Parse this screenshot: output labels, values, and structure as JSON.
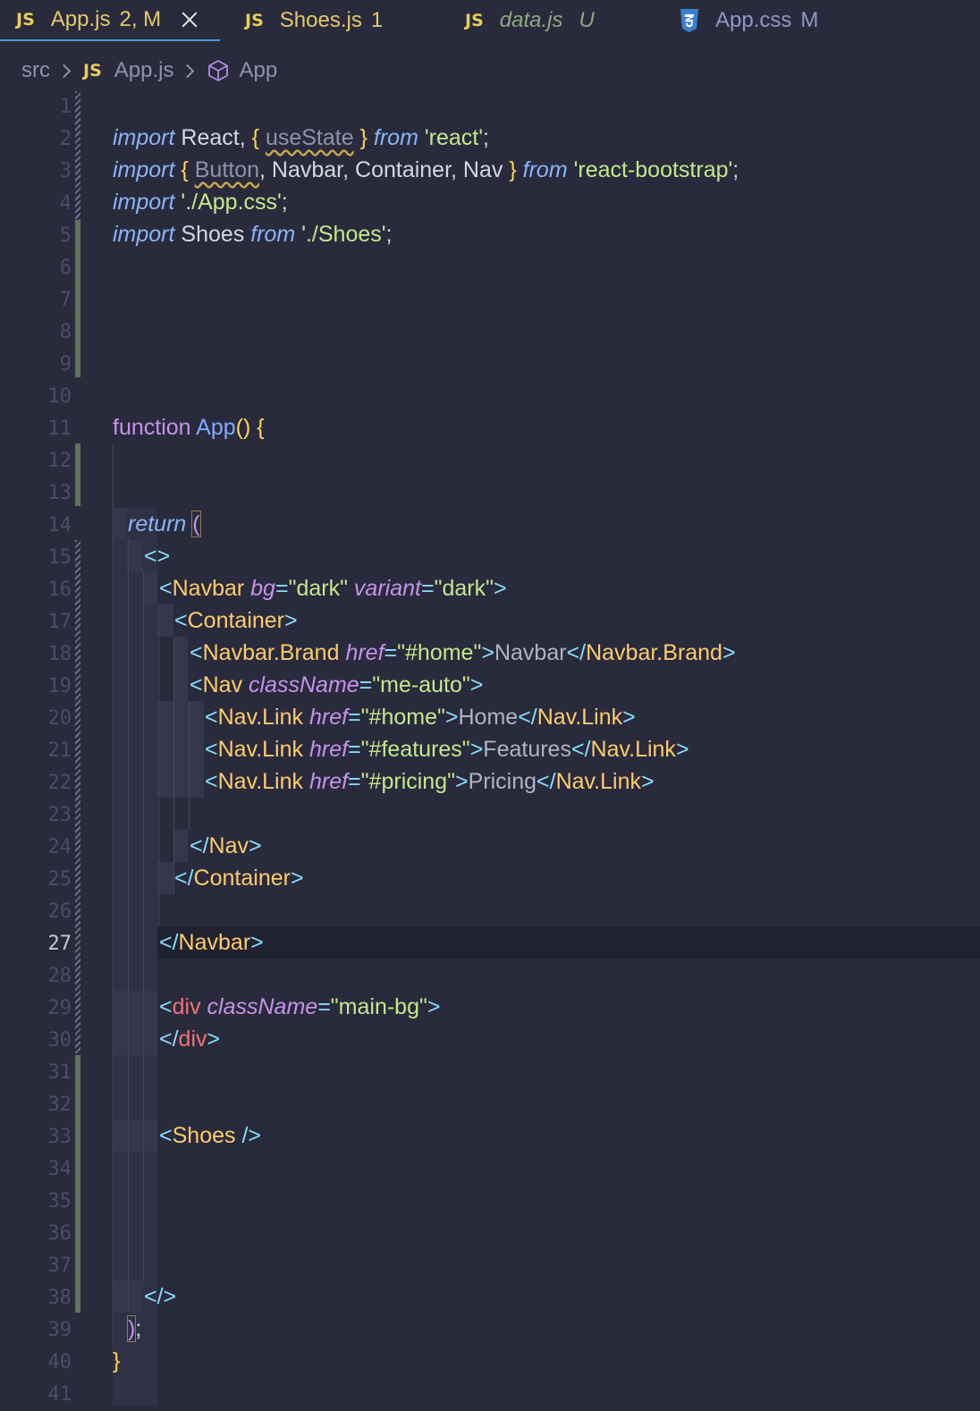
{
  "tabs": [
    {
      "name": "App.js",
      "status": "2, M",
      "icon": "js-icon",
      "color": "#e6c86a",
      "status_color": "#e6c86a",
      "active": true
    },
    {
      "name": "Shoes.js",
      "status": "1",
      "icon": "js-icon",
      "color": "#e6c86a",
      "status_color": "#e6c86a"
    },
    {
      "name": "data.js",
      "status": "U",
      "icon": "js-icon",
      "color": "#8fa77e",
      "status_color": "#8fa77e"
    },
    {
      "name": "App.css",
      "status": "M",
      "icon": "css3-icon",
      "color": "#8f96c4",
      "status_color": "#8f96c4"
    }
  ],
  "tab_badge": "JS",
  "breadcrumb": {
    "folder": "src",
    "file": "App.js",
    "symbol": "App"
  },
  "editor": {
    "current_line": 27,
    "line_numbers": [
      "1",
      "2",
      "3",
      "4",
      "5",
      "6",
      "7",
      "8",
      "9",
      "10",
      "11",
      "12",
      "13",
      "14",
      "15",
      "16",
      "17",
      "18",
      "19",
      "20",
      "21",
      "22",
      "23",
      "24",
      "25",
      "26",
      "27",
      "28",
      "29",
      "30",
      "31",
      "32",
      "33",
      "34",
      "35",
      "36",
      "37",
      "38",
      "39",
      "40",
      "41"
    ]
  },
  "code": {
    "l2": {
      "a": "import",
      "b": " React, ",
      "c": "{",
      "d": " ",
      "e": "useState",
      "f": " ",
      "g": "}",
      "h": " ",
      "i": "from",
      "j": " ",
      "k": "'react'",
      "l": ";"
    },
    "l3": {
      "a": "import",
      "b": " ",
      "c": "{",
      "d": " ",
      "e": "Button",
      "f": ", Navbar, Container, Nav ",
      "g": "}",
      "h": " ",
      "i": "from",
      "j": " ",
      "k": "'react-bootstrap'",
      "l": ";"
    },
    "l4": {
      "a": "import",
      "b": " ",
      "k": "'./App.css'",
      "l": ";"
    },
    "l5": {
      "a": "import",
      "b": " Shoes ",
      "i": "from",
      "j": " ",
      "k": "'./Shoes'",
      "l": ";"
    },
    "l11": {
      "a": "function",
      "b": " ",
      "c": "App",
      "d": "()",
      "e": " ",
      "f": "{"
    },
    "l14": {
      "a": "return",
      "b": " ",
      "c": "("
    },
    "l15": {
      "a": "<>"
    },
    "l16": {
      "a": "<",
      "b": "Navbar",
      "c": " ",
      "d": "bg",
      "e": "=",
      "f": "\"dark\"",
      "g": " ",
      "h": "variant",
      "i": "=",
      "j": "\"dark\"",
      "k": ">"
    },
    "l17": {
      "a": "<",
      "b": "Container",
      "c": ">"
    },
    "l18": {
      "a": "<",
      "b": "Navbar.Brand",
      "c": " ",
      "d": "href",
      "e": "=",
      "f": "\"#home\"",
      "g": ">",
      "h": "Navbar",
      "i": "</",
      "j": "Navbar.Brand",
      "k": ">"
    },
    "l19": {
      "a": "<",
      "b": "Nav",
      "c": " ",
      "d": "className",
      "e": "=",
      "f": "\"me-auto\"",
      "g": ">"
    },
    "l20": {
      "a": "<",
      "b": "Nav.Link",
      "c": " ",
      "d": "href",
      "e": "=",
      "f": "\"#home\"",
      "g": ">",
      "h": "Home",
      "i": "</",
      "j": "Nav.Link",
      "k": ">"
    },
    "l21": {
      "a": "<",
      "b": "Nav.Link",
      "c": " ",
      "d": "href",
      "e": "=",
      "f": "\"#features\"",
      "g": ">",
      "h": "Features",
      "i": "</",
      "j": "Nav.Link",
      "k": ">"
    },
    "l22": {
      "a": "<",
      "b": "Nav.Link",
      "c": " ",
      "d": "href",
      "e": "=",
      "f": "\"#pricing\"",
      "g": ">",
      "h": "Pricing",
      "i": "</",
      "j": "Nav.Link",
      "k": ">"
    },
    "l24": {
      "a": "</",
      "b": "Nav",
      "c": ">"
    },
    "l25": {
      "a": "</",
      "b": "Container",
      "c": ">"
    },
    "l27": {
      "a": "</",
      "b": "Navbar",
      "c": ">"
    },
    "l29": {
      "a": "<",
      "b": "div",
      "c": " ",
      "d": "className",
      "e": "=",
      "f": "\"main-bg\"",
      "g": ">"
    },
    "l30": {
      "a": "</",
      "b": "div",
      "c": ">"
    },
    "l33": {
      "a": "<",
      "b": "Shoes",
      "c": " />"
    },
    "l38": {
      "a": "</>"
    },
    "l39": {
      "a": ")",
      "b": ";"
    },
    "l40": {
      "a": "}"
    }
  }
}
